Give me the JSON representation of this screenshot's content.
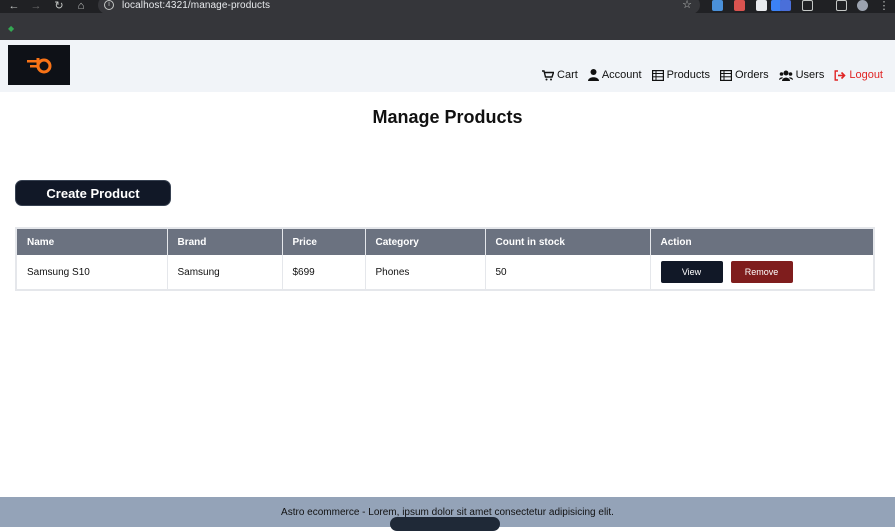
{
  "browser": {
    "url": "localhost:4321/manage-products"
  },
  "header": {
    "logo_alt": "logo",
    "nav": {
      "cart": "Cart",
      "account": "Account",
      "products": "Products",
      "orders": "Orders",
      "users": "Users",
      "logout": "Logout"
    },
    "logout_color": "#e02424",
    "background": "#f1f4f8"
  },
  "main": {
    "title": "Manage Products",
    "create_button": "Create Product",
    "table": {
      "columns": [
        "Name",
        "Brand",
        "Price",
        "Category",
        "Count in stock",
        "Action"
      ],
      "rows": [
        {
          "name": "Samsung S10",
          "brand": "Samsung",
          "price": "$699",
          "category": "Phones",
          "count": "50",
          "view_label": "View",
          "remove_label": "Remove"
        }
      ]
    }
  },
  "footer": {
    "text": "Astro ecommerce - Lorem, ipsum dolor sit amet consectetur adipisicing elit."
  }
}
